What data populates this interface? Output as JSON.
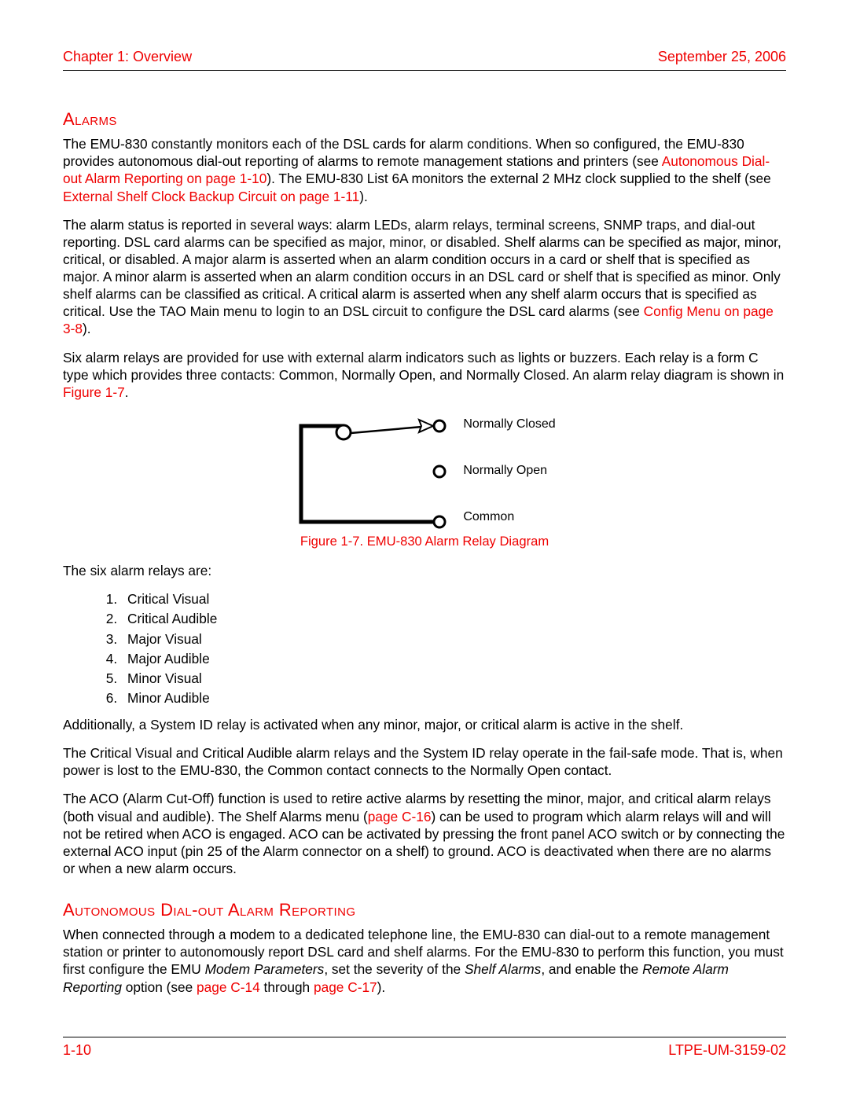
{
  "header": {
    "left": "Chapter 1: Overview",
    "right": "September 25, 2006"
  },
  "footer": {
    "left": "1-10",
    "right": "LTPE-UM-3159-02"
  },
  "sections": {
    "alarms_title": "Alarms",
    "dialout_title": "Autonomous Dial-out Alarm Reporting"
  },
  "para": {
    "a1_pre": "The EMU-830 constantly monitors each of the DSL cards for alarm conditions. When so configured, the EMU-830 provides autonomous dial-out reporting of alarms to remote management stations and printers (see ",
    "a1_link1": " Autonomous Dial-out Alarm Reporting  on page 1-10",
    "a1_mid": "). The EMU-830 List 6A monitors the external 2 MHz clock supplied to the shelf (see ",
    "a1_link2": " External Shelf Clock Backup Circuit  on page 1-11",
    "a1_post": ").",
    "a2_pre": "The alarm status is reported in several ways: alarm LEDs, alarm relays, terminal screens, SNMP traps, and dial-out reporting. DSL card alarms can be specified as major, minor, or disabled. Shelf alarms can be specified as major, minor, critical, or disabled. A major alarm is asserted when an alarm condition occurs in a card or shelf that is specified as major. A minor alarm is asserted when an alarm condition occurs in an DSL card or shelf that is specified as minor. Only shelf alarms can be classified as critical. A critical alarm is asserted when any shelf alarm occurs that is specified as critical. Use the TAO Main menu to login to an DSL circuit to configure the DSL card alarms (see ",
    "a2_link": " Config Menu  on page 3-8",
    "a2_post": ").",
    "a3_pre": "Six alarm relays are provided for use with external alarm indicators such as lights or buzzers. Each relay is a form C type which provides three contacts: Common, Normally Open, and Normally Closed. An alarm relay diagram is shown in ",
    "a3_link": "Figure 1-7",
    "a3_post": ".",
    "relay_intro": "The six alarm relays are:",
    "p_sysid": "Additionally, a System ID relay is activated when any minor, major, or critical alarm is active in the shelf.",
    "p_failsafe": "The Critical Visual and Critical Audible alarm relays and the System ID relay operate in the fail-safe mode. That is, when power is lost to the EMU-830, the Common contact connects to the Normally Open contact.",
    "aco_pre": "The ACO (Alarm Cut-Off) function is used to retire active alarms by resetting the minor, major, and critical alarm relays (both visual and audible). The Shelf Alarms menu (",
    "aco_link": "page C-16",
    "aco_post": ") can be used to program which alarm relays will and will not be retired when ACO is engaged. ACO can be activated by pressing the front panel ACO switch or by connecting the external ACO input (pin 25 of the Alarm connector on a shelf) to ground. ACO is deactivated when there are no alarms or when a new alarm occurs.",
    "d1_pre": "When connected through a modem to a dedicated telephone line, the EMU-830 can dial-out to a remote management station or printer to autonomously report DSL card and shelf alarms. For the EMU-830 to perform this function, you must first configure the EMU ",
    "d1_i1": "Modem Parameters",
    "d1_mid1": ", set the severity of the ",
    "d1_i2": "Shelf Alarms",
    "d1_mid2": ", and enable the ",
    "d1_i3": "Remote Alarm Reporting",
    "d1_mid3": " option (see ",
    "d1_link1": "page C-14",
    "d1_mid4": " through ",
    "d1_link2": "page C-17",
    "d1_post": ")."
  },
  "figure": {
    "caption": "Figure 1-7. EMU-830 Alarm Relay Diagram",
    "labels": {
      "nc": "Normally Closed",
      "no": "Normally Open",
      "com": "Common"
    }
  },
  "relays": [
    "Critical Visual",
    "Critical Audible",
    "Major Visual",
    "Major Audible",
    "Minor Visual",
    "Minor Audible"
  ]
}
